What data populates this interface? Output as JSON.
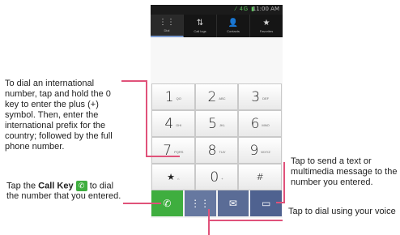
{
  "status": {
    "time": "11:00 AM",
    "icons": "⁄ 4G ▮"
  },
  "tabs": [
    {
      "label": "Dial",
      "icon": "keypad-icon",
      "glyph": "⋮⋮"
    },
    {
      "label": "Call logs",
      "icon": "call-logs-icon",
      "glyph": "⇅"
    },
    {
      "label": "Contacts",
      "icon": "contacts-icon",
      "glyph": "👤"
    },
    {
      "label": "Favorites",
      "icon": "star-icon",
      "glyph": "★"
    }
  ],
  "keys": [
    {
      "digit": "1",
      "letters": "QO"
    },
    {
      "digit": "2",
      "letters": "ABC"
    },
    {
      "digit": "3",
      "letters": "DEF"
    },
    {
      "digit": "4",
      "letters": "GHI"
    },
    {
      "digit": "5",
      "letters": "JKL"
    },
    {
      "digit": "6",
      "letters": "MNO"
    },
    {
      "digit": "7",
      "letters": "PQRS"
    },
    {
      "digit": "8",
      "letters": "TUV"
    },
    {
      "digit": "9",
      "letters": "WXYZ"
    },
    {
      "digit": "★",
      "letters": "⌂"
    },
    {
      "digit": "0",
      "letters": "+"
    },
    {
      "digit": "#",
      "letters": ""
    }
  ],
  "actions": {
    "call_glyph": "✆",
    "voice_glyph": "⋮⋮",
    "msg_glyph": "✉",
    "more_glyph": "▭"
  },
  "callouts": {
    "international": "To dial an international number, tap and hold the 0 key to enter the plus (+) symbol. Then, enter the international prefix for the country; followed by the full phone number.",
    "call_prefix": "Tap the",
    "call_key": "Call Key",
    "call_suffix": "to dial the number that you entered.",
    "text_message": "Tap to send a text or multimedia message to the number you entered.",
    "voice": "Tap to dial using your voice"
  }
}
